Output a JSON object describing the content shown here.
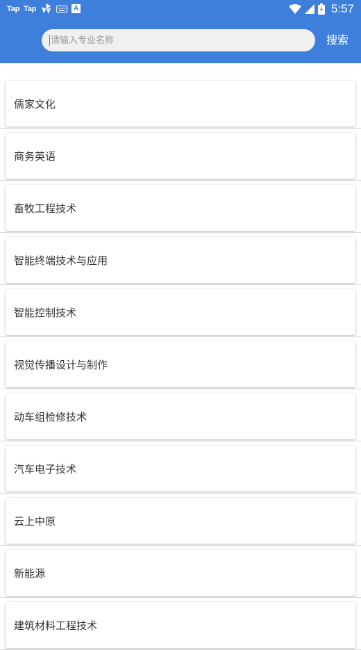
{
  "status_bar": {
    "app_icon_1": "Tap",
    "app_icon_2": "Tap",
    "a_badge": "A",
    "time": "5:57"
  },
  "search": {
    "placeholder": "请输入专业名称",
    "value": "",
    "button_label": "搜索"
  },
  "majors": [
    "儒家文化",
    "商务英语",
    "畜牧工程技术",
    "智能终端技术与应用",
    "智能控制技术",
    "视觉传播设计与制作",
    "动车组检修技术",
    "汽车电子技术",
    "云上中原",
    "新能源",
    "建筑材料工程技术"
  ],
  "colors": {
    "header": "#3f7fdc",
    "search_bg": "#f0f0f0",
    "text": "#333333"
  }
}
